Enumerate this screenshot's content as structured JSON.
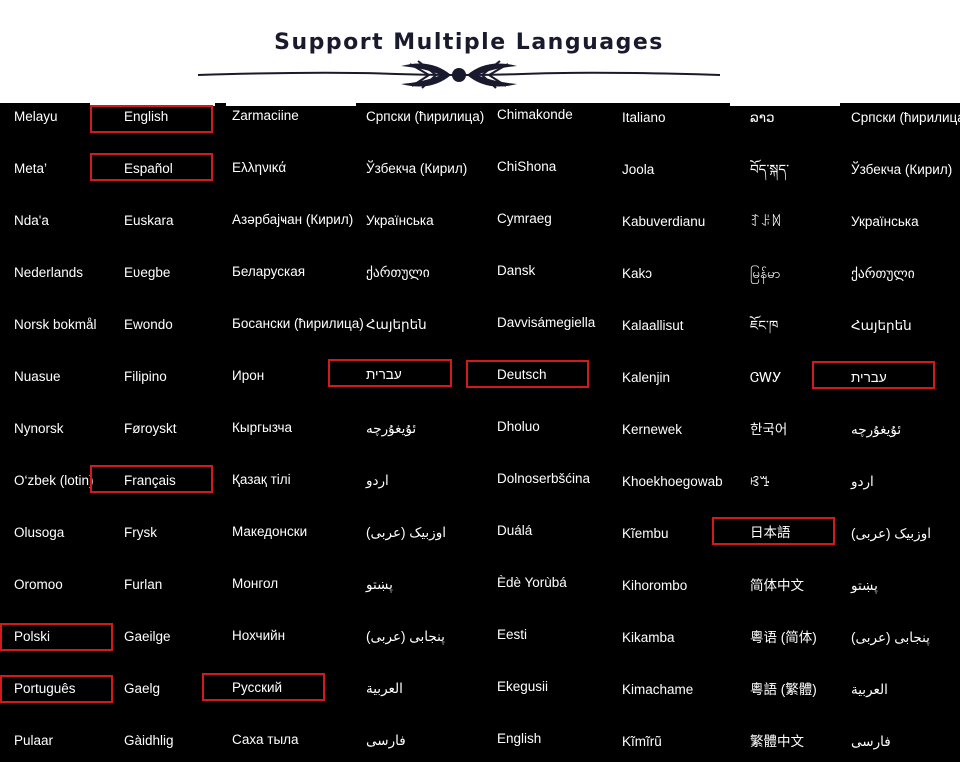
{
  "header": {
    "title": "Support Multiple Languages"
  },
  "accent_color": "#d21a1a",
  "columns": [
    [
      "Melayu",
      "Meta’",
      "Nda'a",
      "Nederlands",
      "Norsk bokmål",
      "Nuasue",
      "Nynorsk",
      "O‘zbek (lotin)",
      "Olusoga",
      "Oromoo",
      "Polski",
      "Português",
      "Pulaar"
    ],
    [
      "English",
      "Español",
      "Euskara",
      "Eʋegbe",
      "Ewondo",
      "Filipino",
      "Føroyskt",
      "Français",
      "Frysk",
      "Furlan",
      "Gaeilge",
      "Gaelg",
      "Gàidhlig"
    ],
    [
      "Zarmaciine",
      "Ελληνικά",
      "Азәрбајҹан (Кирил)",
      "Беларуская",
      "Босански (ћирилица)",
      "Ирон",
      "Кыргызча",
      "Қазақ тілі",
      "Македонски",
      "Монгол",
      "Нохчийн",
      "Русский",
      "Саха тыла"
    ],
    [
      "Српски (ћирилица)",
      "Ўзбекча (Кирил)",
      "Українська",
      "ქართული",
      "Հայերեն",
      "עברית",
      "ئۇيغۇرچە",
      "اردو",
      "اوزبیک (عربی)",
      "پښتو",
      "پنجابی (عربی)",
      "العربية",
      "فارسی"
    ],
    [
      "Chimakonde",
      "ChiShona",
      "Cymraeg",
      "Dansk",
      "Davvisámegiella",
      "Deutsch",
      "Dholuo",
      "Dolnoserbšćina",
      "Duálá",
      "Èdè Yorùbá",
      "Eesti",
      "Ekegusii",
      "English"
    ],
    [
      "Italiano",
      "Joola",
      "Kabuverdianu",
      "Kakɔ",
      "Kalaallisut",
      "Kalenjin",
      "Kernewek",
      "Khoekhoegowab",
      "Kĩembu",
      "Kihorombo",
      "Kikamba",
      "Kimachame",
      "Kĩmĩrũ"
    ],
    [
      "ລາວ",
      "བོད་སྐད་",
      "ꆈꌠꉙ",
      "မြန်မာ",
      "ཇོང་ཁ",
      "ᏣᎳᎩ",
      "한국어",
      "ꕙꔤ",
      "日本語",
      "简体中文",
      "粵语 (简体)",
      "粵語 (繁體)",
      "繁體中文"
    ],
    [
      "Српски (ћирилица)",
      "Ўзбекча (Кирил)",
      "Українська",
      "ქართული",
      "Հայերեն",
      "עברית",
      "ئۇيغۇرچە",
      "اردو",
      "اوزبیک (عربی)",
      "پښتو",
      "پنجابی (عربی)",
      "العربية",
      "فارسی"
    ]
  ]
}
